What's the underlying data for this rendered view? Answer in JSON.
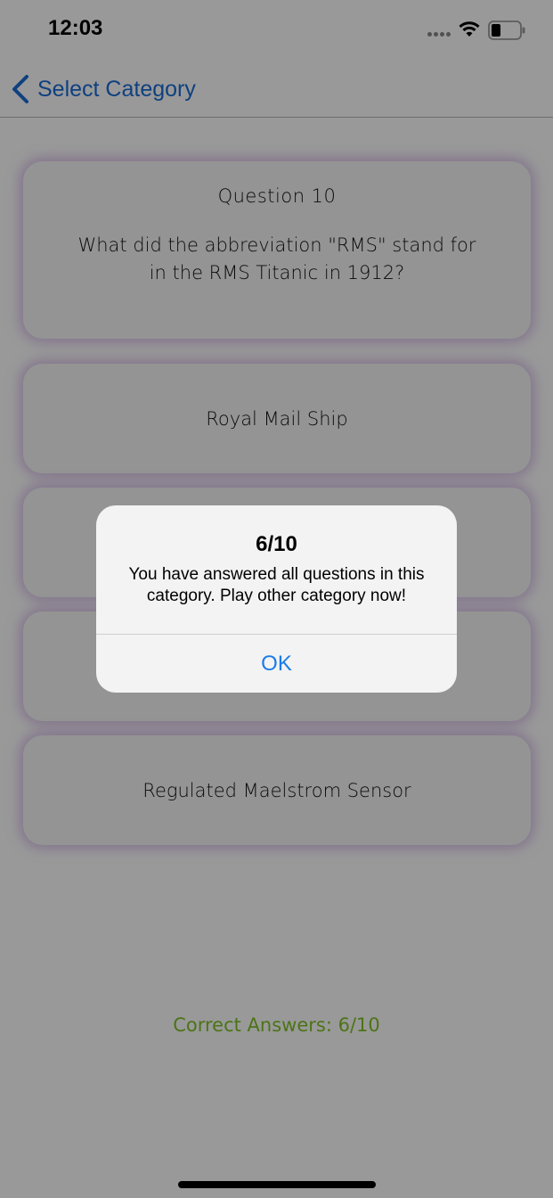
{
  "status_bar": {
    "time": "12:03",
    "battery_icon": "battery-icon",
    "wifi_icon": "wifi-icon"
  },
  "nav": {
    "back_icon": "chevron-left-icon",
    "back_label": "Select Category"
  },
  "question": {
    "number_label": "Question 10",
    "text": "What did the abbreviation \"RMS\" stand for in the RMS Titanic in 1912?"
  },
  "answers": [
    {
      "label": "Royal Mail Ship"
    },
    {
      "label": ""
    },
    {
      "label": ""
    },
    {
      "label": "Regulated Maelstrom Sensor"
    }
  ],
  "score": {
    "text": "Correct Answers: 6/10",
    "correct": 6,
    "total": 10
  },
  "alert": {
    "title": "6/10",
    "message": "You have answered all questions in this category. Play other category now!",
    "ok_label": "OK"
  },
  "colors": {
    "accent_blue": "#1a6bd6",
    "score_green": "#7fc226",
    "card_glow": "#ba8cd7"
  }
}
